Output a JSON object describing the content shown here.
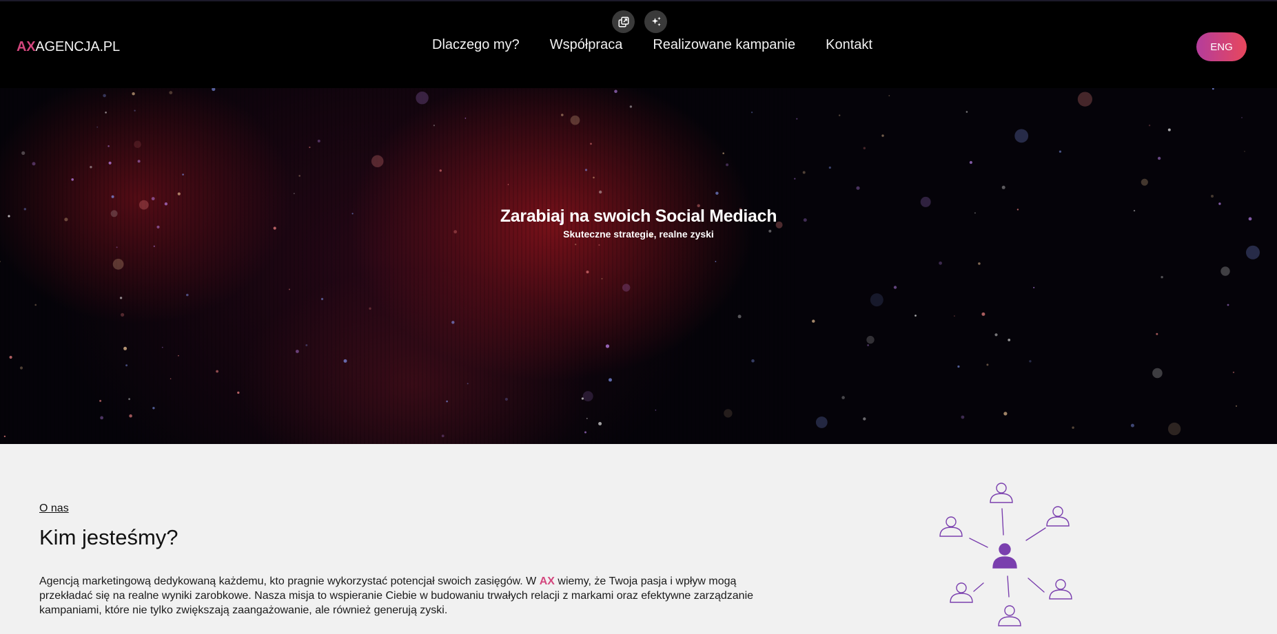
{
  "header": {
    "logo_accent": "AX",
    "logo_main": "AGENCJA.PL",
    "nav": [
      {
        "label": "Dlaczego my?"
      },
      {
        "label": "Współpraca"
      },
      {
        "label": "Realizowane kampanie"
      },
      {
        "label": "Kontakt"
      }
    ],
    "lang_button": "ENG"
  },
  "tools": {
    "left_icon": "external-window-icon",
    "right_icon": "sparkles-icon"
  },
  "hero": {
    "title": "Zarabiaj na swoich Social Mediach",
    "subtitle": "Skuteczne strategie, realne zyski"
  },
  "about": {
    "kicker": "O nas",
    "title": "Kim jesteśmy?",
    "text_before": "Agencją marketingową dedykowaną każdemu, kto pragnie wykorzystać potencjał swoich zasięgów. W ",
    "text_accent": "AX",
    "text_after": " wiemy, że Twoja pasja i wpływ mogą przekładać się na realne wyniki zarobkowe. Nasza misja to wspieranie Ciebie w budowaniu trwałych relacji z markami oraz efektywne zarządzanie kampaniami, które nie tylko zwiększają zaangażowanie, ale również generują zyski.",
    "illustration": "people-network-icon"
  },
  "colors": {
    "accent": "#d3467d",
    "lang_gradient_start": "#b43d9c",
    "lang_gradient_end": "#e8475c",
    "illustration": "#7a3fae"
  }
}
